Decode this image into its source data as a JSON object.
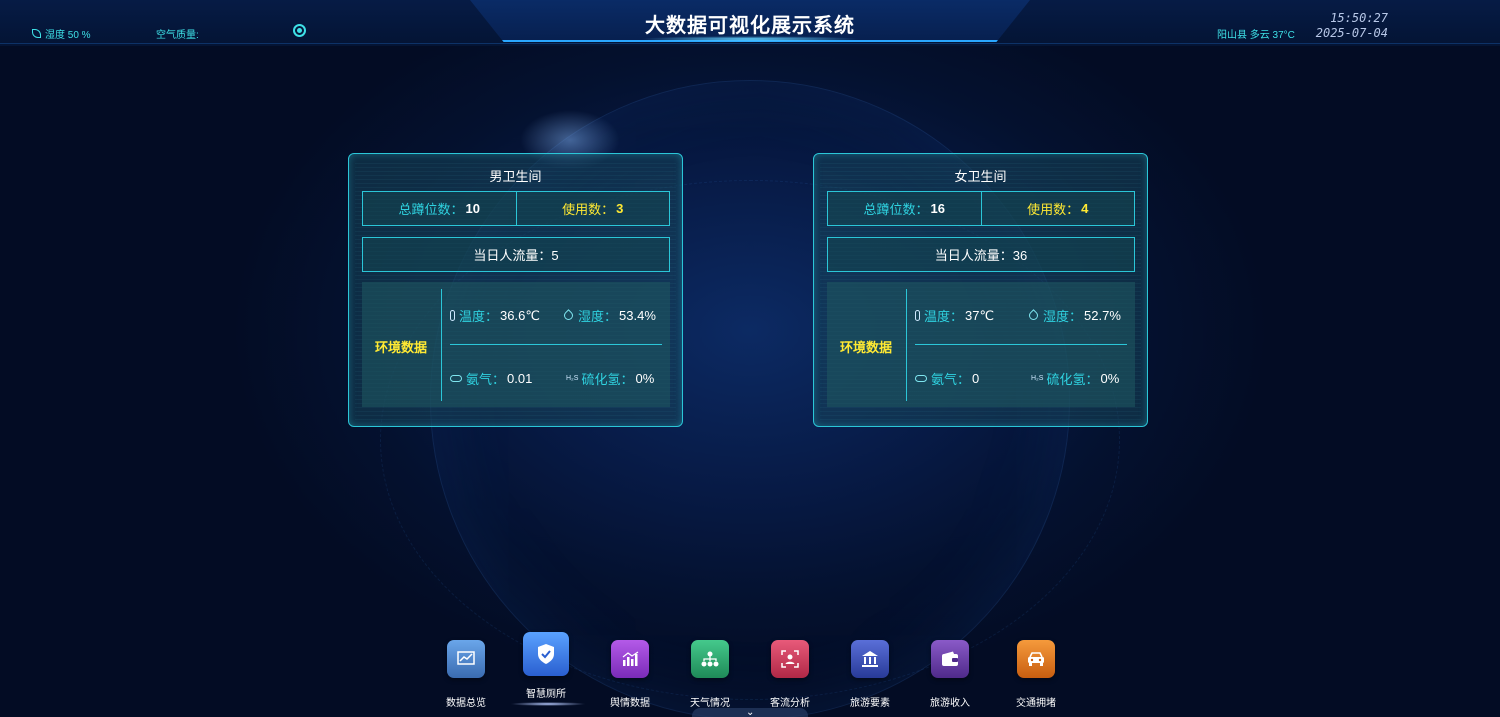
{
  "header": {
    "title": "大数据可视化展示系统",
    "humidity_label": "湿度 50 %",
    "air_quality_label": "空气质量:",
    "weather": "阳山县 多云 37°C",
    "time": "15:50:27",
    "date": "2025-07-04"
  },
  "panels": [
    {
      "title": "男卫生间",
      "total_label": "总蹲位数：",
      "total_value": "10",
      "used_label": "使用数：",
      "used_value": "3",
      "flow_text": "当日人流量：5",
      "env_label": "环境数据",
      "temp_label": "温度：",
      "temp_value": "36.6℃",
      "humidity_label": "湿度：",
      "humidity_value": "53.4%",
      "ammonia_label": "氨气：",
      "ammonia_value": "0.01",
      "h2s_label": "硫化氢：",
      "h2s_value": "0%"
    },
    {
      "title": "女卫生间",
      "total_label": "总蹲位数：",
      "total_value": "16",
      "used_label": "使用数：",
      "used_value": "4",
      "flow_text": "当日人流量：36",
      "env_label": "环境数据",
      "temp_label": "温度：",
      "temp_value": "37℃",
      "humidity_label": "湿度：",
      "humidity_value": "52.7%",
      "ammonia_label": "氨气：",
      "ammonia_value": "0",
      "h2s_label": "硫化氢：",
      "h2s_value": "0%"
    }
  ],
  "h2s_symbol": "H₂S",
  "nav": [
    {
      "label": "数据总览",
      "icon": "chart-icon",
      "color": "#4a7fc4"
    },
    {
      "label": "智慧厕所",
      "icon": "shield-icon",
      "color": "#3d7de0",
      "active": true
    },
    {
      "label": "舆情数据",
      "icon": "bar-chart-icon",
      "color": "#9b3fd6"
    },
    {
      "label": "天气情况",
      "icon": "network-icon",
      "color": "#2fae74"
    },
    {
      "label": "客流分析",
      "icon": "face-scan-icon",
      "color": "#d03a5c"
    },
    {
      "label": "旅游要素",
      "icon": "bank-icon",
      "color": "#3b4fb8"
    },
    {
      "label": "旅游收入",
      "icon": "wallet-icon",
      "color": "#6a3fa8"
    },
    {
      "label": "交通拥堵",
      "icon": "car-icon",
      "color": "#e07a1f"
    }
  ],
  "bottom_tab_glyph": "⌄"
}
